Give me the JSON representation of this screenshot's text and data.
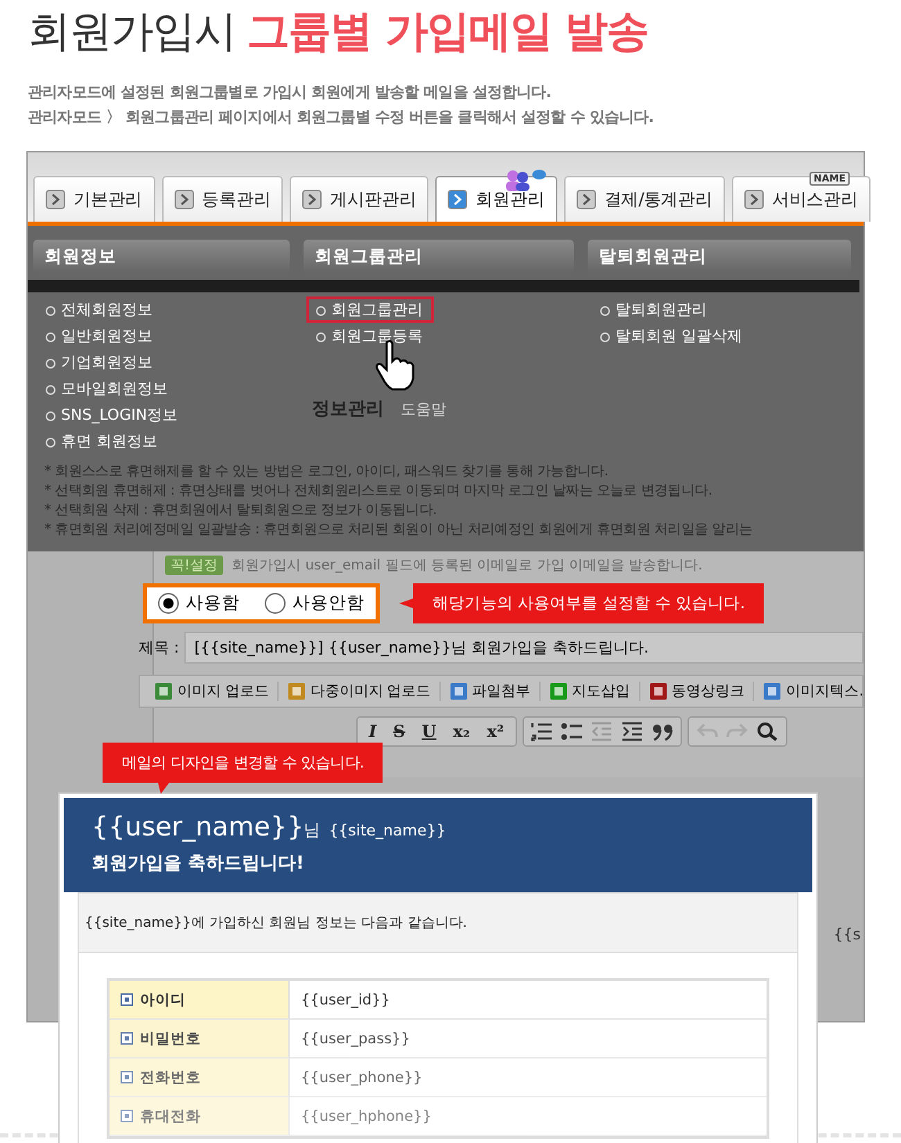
{
  "title": {
    "plain": "회원가입시",
    "accent": "그룹별 가입메일 발송"
  },
  "description": [
    "관리자모드에 설정된 회원그룹별로 가입시 회원에게 발송할 메일을 설정합니다.",
    "관리자모드 〉 회원그룹관리 페이지에서 회원그룹별 수정 버튼을 클릭해서 설정할 수 있습니다."
  ],
  "tabs": [
    {
      "label": "기본관리",
      "selected": false
    },
    {
      "label": "등록관리",
      "selected": false
    },
    {
      "label": "게시판관리",
      "selected": false
    },
    {
      "label": "회원관리",
      "selected": true
    },
    {
      "label": "결제/통계관리",
      "selected": false
    },
    {
      "label": "서비스관리",
      "selected": false
    }
  ],
  "name_badge": "NAME",
  "menu_columns": [
    {
      "heading": "회원정보",
      "items": [
        {
          "label": "전체회원정보",
          "highlighted": false
        },
        {
          "label": "일반회원정보",
          "highlighted": false
        },
        {
          "label": "기업회원정보",
          "highlighted": false
        },
        {
          "label": "모바일회원정보",
          "highlighted": false
        },
        {
          "label": "SNS_LOGIN정보",
          "highlighted": false
        },
        {
          "label": "휴면 회원정보",
          "highlighted": false
        }
      ]
    },
    {
      "heading": "회원그룹관리",
      "items": [
        {
          "label": "회원그룹관리",
          "highlighted": true
        },
        {
          "label": "회원그룹등록",
          "highlighted": false
        }
      ]
    },
    {
      "heading": "탈퇴회원관리",
      "items": [
        {
          "label": "탈퇴회원관리",
          "highlighted": false
        },
        {
          "label": "탈퇴회원 일괄삭제",
          "highlighted": false
        }
      ]
    }
  ],
  "background_notes": {
    "heading": "정보관리",
    "subheading": "도움말",
    "lines": [
      "* 회원스스로 휴면해제를 할 수 있는 방법은 로그인, 아이디, 패스워드 찾기를 통해 가능합니다.",
      "* 선택회원 휴면해제 : 휴면상태를 벗어나 전체회원리스트로 이동되며 마지막 로그인 날짜는 오늘로 변경됩니다.",
      "* 선택회원 삭제 : 휴면회원에서 탈퇴회원으로 정보가 이동됩니다.",
      "* 휴면회원 처리예정메일 일괄발송 : 휴면회원으로 처리된 회원이 아닌 처리예정인 회원에게 휴면회원 처리일을 알리는"
    ]
  },
  "notice": {
    "badge": "꼭!설정",
    "text": "회원가입시 user_email 필드에 등록된 이메일로 가입 이메일을 발송합니다."
  },
  "radios": [
    {
      "label": "사용함",
      "selected": true
    },
    {
      "label": "사용안함",
      "selected": false
    }
  ],
  "radio_callout": "해당기능의 사용여부를 설정할 수 있습니다.",
  "subject": {
    "label": "제목 :",
    "value": "[{{site_name}}] {{user_name}}님 회원가입을 축하드립니다."
  },
  "editor_buttons": [
    {
      "label": "이미지 업로드",
      "kind": "image"
    },
    {
      "label": "다중이미지 업로드",
      "kind": "images"
    },
    {
      "label": "파일첨부",
      "kind": "file"
    },
    {
      "label": "지도삽입",
      "kind": "map"
    },
    {
      "label": "동영상링크",
      "kind": "video"
    },
    {
      "label": "이미지텍스.",
      "kind": "text"
    }
  ],
  "format_buttons": [
    {
      "label": "I",
      "kind": "italic"
    },
    {
      "label": "S",
      "kind": "strike"
    },
    {
      "label": "U",
      "kind": "underline"
    },
    {
      "label": "x₂",
      "kind": "plain"
    },
    {
      "label": "x²",
      "kind": "plain"
    }
  ],
  "design_callout": "메일의 디자인을 변경할 수 있습니다.",
  "mail": {
    "user": "{{user_name}}",
    "suffix": "님",
    "site": "{{site_name}}",
    "greeting": "회원가입을 축하드립니다!",
    "intro": "{{site_name}}에 가입하신 회원님 정보는 다음과 같습니다.",
    "rows": [
      {
        "label": "아이디",
        "value": "{{user_id}}"
      },
      {
        "label": "비밀번호",
        "value": "{{user_pass}}"
      },
      {
        "label": "전화번호",
        "value": "{{user_phone}}"
      },
      {
        "label": "휴대전화",
        "value": "{{user_hphone}}"
      }
    ]
  },
  "peek_text": "{{s"
}
